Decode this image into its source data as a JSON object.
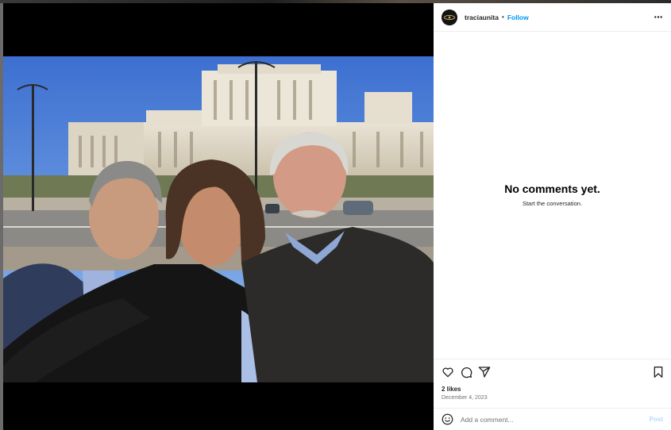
{
  "post": {
    "username": "traciaunita",
    "separator": "•",
    "follow_label": "Follow",
    "more_icon": "more-options-icon",
    "likes": "2 likes",
    "date": "December 4, 2023"
  },
  "comments": {
    "empty_title": "No comments yet.",
    "empty_subtitle": "Start the conversation."
  },
  "comment_box": {
    "placeholder": "Add a comment...",
    "post_label": "Post"
  },
  "actions": {
    "icons": [
      "heart-icon",
      "comment-icon",
      "share-icon",
      "bookmark-icon"
    ]
  },
  "colors": {
    "follow": "#0095f6",
    "post_disabled": "#b3dbff",
    "text": "#262626",
    "muted": "#737373",
    "border": "#efefef"
  }
}
